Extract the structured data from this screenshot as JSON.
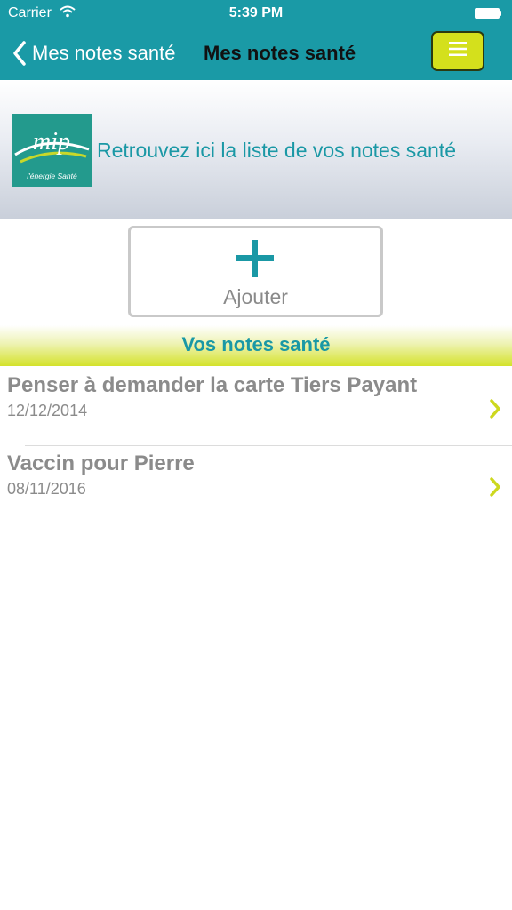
{
  "status_bar": {
    "carrier": "Carrier",
    "time": "5:39 PM"
  },
  "nav": {
    "back_label": "Mes notes santé",
    "title": "Mes notes santé"
  },
  "banner": {
    "logo_tagline": "l'énergie Santé",
    "text": "Retrouvez ici la liste de vos notes santé"
  },
  "add_button": {
    "label": "Ajouter"
  },
  "section": {
    "title": "Vos notes santé"
  },
  "notes": [
    {
      "title": "Penser à demander la carte Tiers Payant",
      "date": "12/12/2014"
    },
    {
      "title": "Vaccin pour Pierre",
      "date": "08/11/2016"
    }
  ],
  "colors": {
    "teal": "#1a9aa6",
    "accent_green": "#d4e01c",
    "text_grey": "#8b8b8b"
  }
}
